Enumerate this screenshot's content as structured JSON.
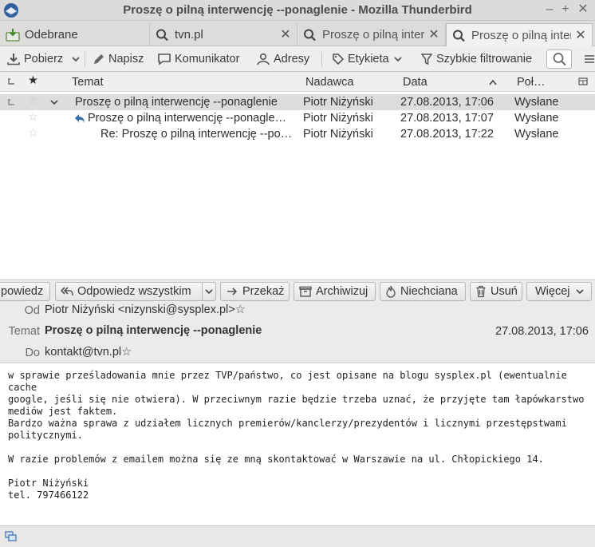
{
  "window": {
    "title": "Proszę o pilną interwencję --ponaglenie - Mozilla Thunderbird",
    "min_glyph": "–",
    "max_glyph": "+",
    "close_glyph": "✕"
  },
  "tabs": [
    {
      "label": "Odebrane",
      "icon": "inbox-icon",
      "closable": false,
      "active": false
    },
    {
      "label": "tvn.pl",
      "icon": "search-icon",
      "closable": true,
      "active": false
    },
    {
      "label": "Proszę o pilną interwencję --ponaglenie",
      "icon": "search-icon",
      "closable": true,
      "active": false
    },
    {
      "label": "Proszę o pilną interwencję --ponaglenie",
      "icon": "search-icon",
      "closable": true,
      "active": true
    }
  ],
  "toolbar": {
    "get_mail": "Pobierz",
    "write": "Napisz",
    "chat": "Komunikator",
    "address_book": "Adresy",
    "tag": "Etykieta",
    "quick_filter": "Szybkie filtrowanie"
  },
  "thread_columns": {
    "subject": "Temat",
    "sender": "Nadawca",
    "date": "Data",
    "account": "Poł…"
  },
  "threads": [
    {
      "subject": "Proszę o pilną interwencję  --ponaglenie",
      "sender": "Piotr Niżyński",
      "date": "27.08.2013, 17:06",
      "account": "Wysłane"
    },
    {
      "subject": "Proszę o pilną interwencję  --ponaglenie",
      "sender": "Piotr Niżyński",
      "date": "27.08.2013, 17:07",
      "account": "Wysłane"
    },
    {
      "subject": "Re: Proszę o pilną interwencję --ponaglenie",
      "sender": "Piotr Niżyński",
      "date": "27.08.2013, 17:22",
      "account": "Wysłane"
    }
  ],
  "actions": {
    "reply": "powiedz",
    "reply_all": "Odpowiedz wszystkim",
    "forward": "Przekaż",
    "archive": "Archiwizuj",
    "junk": "Niechciana",
    "delete": "Usuń",
    "more": "Więcej"
  },
  "message": {
    "from_label": "Od",
    "from": "Piotr Niżyński <nizynski@sysplex.pl>",
    "subject_label": "Temat",
    "subject": "Proszę o pilną interwencję --ponaglenie",
    "date": "27.08.2013, 17:06",
    "to_label": "Do",
    "to": "kontakt@tvn.pl",
    "body": "w sprawie prześladowania mnie przez TVP/państwo, co jest opisane na blogu sysplex.pl (ewentualnie cache\ngoogle, jeśli się nie otwiera). W przeciwnym razie będzie trzeba uznać, że przyjęte tam łapówkarstwo\nmediów jest faktem.\nBardzo ważna sprawa z udziałem licznych premierów/kanclerzy/prezydentów i licznymi przestępstwami\npolitycznymi.\n\nW razie problemów z emailem można się ze mną skontaktować w Warszawie na ul. Chłopickiego 14.\n\nPiotr Niżyński\ntel. 797466122"
  },
  "colors": {
    "accent": "#3b6fb0",
    "selected_row": "#dedddb",
    "star": "#c9c9c9"
  }
}
